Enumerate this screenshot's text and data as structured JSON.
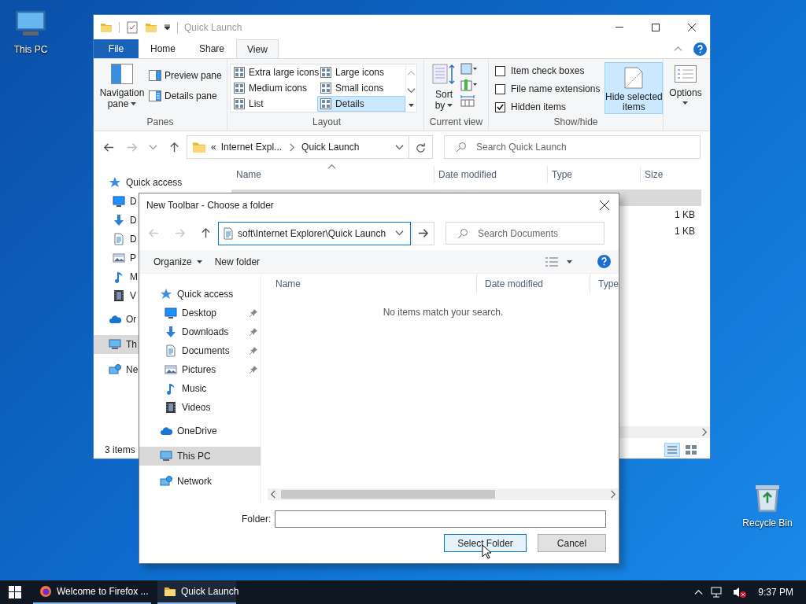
{
  "desktop_icons": [
    {
      "label": "This PC"
    },
    {
      "label": "Recycle Bin"
    }
  ],
  "explorer": {
    "title": "Quick Launch",
    "ribbon_tabs": [
      {
        "label": "File",
        "kind": "file",
        "selected": false
      },
      {
        "label": "Home",
        "kind": "tab",
        "selected": false
      },
      {
        "label": "Share",
        "kind": "tab",
        "selected": false
      },
      {
        "label": "View",
        "kind": "tab",
        "selected": true
      }
    ],
    "panes": {
      "navigation_pane": [
        "Navigation",
        "pane"
      ],
      "preview_pane": "Preview pane",
      "details_pane": "Details pane",
      "label": "Panes"
    },
    "layout": {
      "label": "Layout",
      "options": [
        {
          "label": "Extra large icons",
          "selected": false
        },
        {
          "label": "Large icons",
          "selected": false
        },
        {
          "label": "Medium icons",
          "selected": false
        },
        {
          "label": "Small icons",
          "selected": false
        },
        {
          "label": "List",
          "selected": false
        },
        {
          "label": "Details",
          "selected": true
        }
      ]
    },
    "current_view": {
      "sort_by": [
        "Sort",
        "by"
      ],
      "label": "Current view"
    },
    "show_hide": {
      "label": "Show/hide",
      "checkboxes": [
        {
          "label": "Item check boxes",
          "checked": false
        },
        {
          "label": "File name extensions",
          "checked": false
        },
        {
          "label": "Hidden items",
          "checked": true
        }
      ],
      "hide_selected": {
        "lines": [
          "Hide selected",
          "items"
        ],
        "highlighted": true
      }
    },
    "options": "Options",
    "address": {
      "overflow": "«",
      "crumbs": [
        "Internet Expl...",
        "Quick Launch"
      ]
    },
    "search_placeholder": "Search Quick Launch",
    "columns": [
      "Name",
      "Date modified",
      "Type",
      "Size"
    ],
    "rows": [
      {
        "selected": true
      },
      {
        "size": "1 KB",
        "selected": false
      },
      {
        "size": "1 KB",
        "selected": false
      }
    ],
    "nav": [
      {
        "label": "Quick access",
        "selected": false,
        "children": [
          {
            "label": "D",
            "selected": false
          },
          {
            "label": "D",
            "selected": false
          },
          {
            "label": "D",
            "selected": false
          },
          {
            "label": "P",
            "selected": false
          },
          {
            "label": "M",
            "selected": false
          },
          {
            "label": "V",
            "selected": false
          }
        ]
      },
      {
        "label": "Or",
        "selected": false
      },
      {
        "label": "Th",
        "selected": true
      },
      {
        "label": "Ne",
        "selected": false
      }
    ],
    "status": "3 items"
  },
  "dialog": {
    "title": "New Toolbar - Choose a folder",
    "path": "soft\\Internet Explorer\\Quick Launch",
    "search_placeholder": "Search Documents",
    "toolbar": [
      "Organize",
      "New folder"
    ],
    "nav": [
      {
        "label": "Quick access",
        "selected": false,
        "pinned": false,
        "children": [
          {
            "label": "Desktop",
            "selected": false,
            "pinned": true
          },
          {
            "label": "Downloads",
            "selected": false,
            "pinned": true
          },
          {
            "label": "Documents",
            "selected": false,
            "pinned": true
          },
          {
            "label": "Pictures",
            "selected": false,
            "pinned": true
          },
          {
            "label": "Music",
            "selected": false,
            "pinned": false
          },
          {
            "label": "Videos",
            "selected": false,
            "pinned": false
          }
        ]
      },
      {
        "label": "OneDrive",
        "selected": false,
        "pinned": false
      },
      {
        "label": "This PC",
        "selected": true,
        "pinned": false
      },
      {
        "label": "Network",
        "selected": false,
        "pinned": false
      }
    ],
    "columns": [
      "Name",
      "Date modified",
      "Type"
    ],
    "empty_message": "No items match your search.",
    "folder_label": "Folder:",
    "buttons": [
      {
        "label": "Select Folder",
        "kind": "primary"
      },
      {
        "label": "Cancel",
        "kind": "secondary"
      }
    ]
  },
  "taskbar": {
    "items": [
      {
        "label": "Welcome to Firefox ..."
      },
      {
        "label": "Quick Launch"
      }
    ],
    "time": "9:37 PM"
  }
}
